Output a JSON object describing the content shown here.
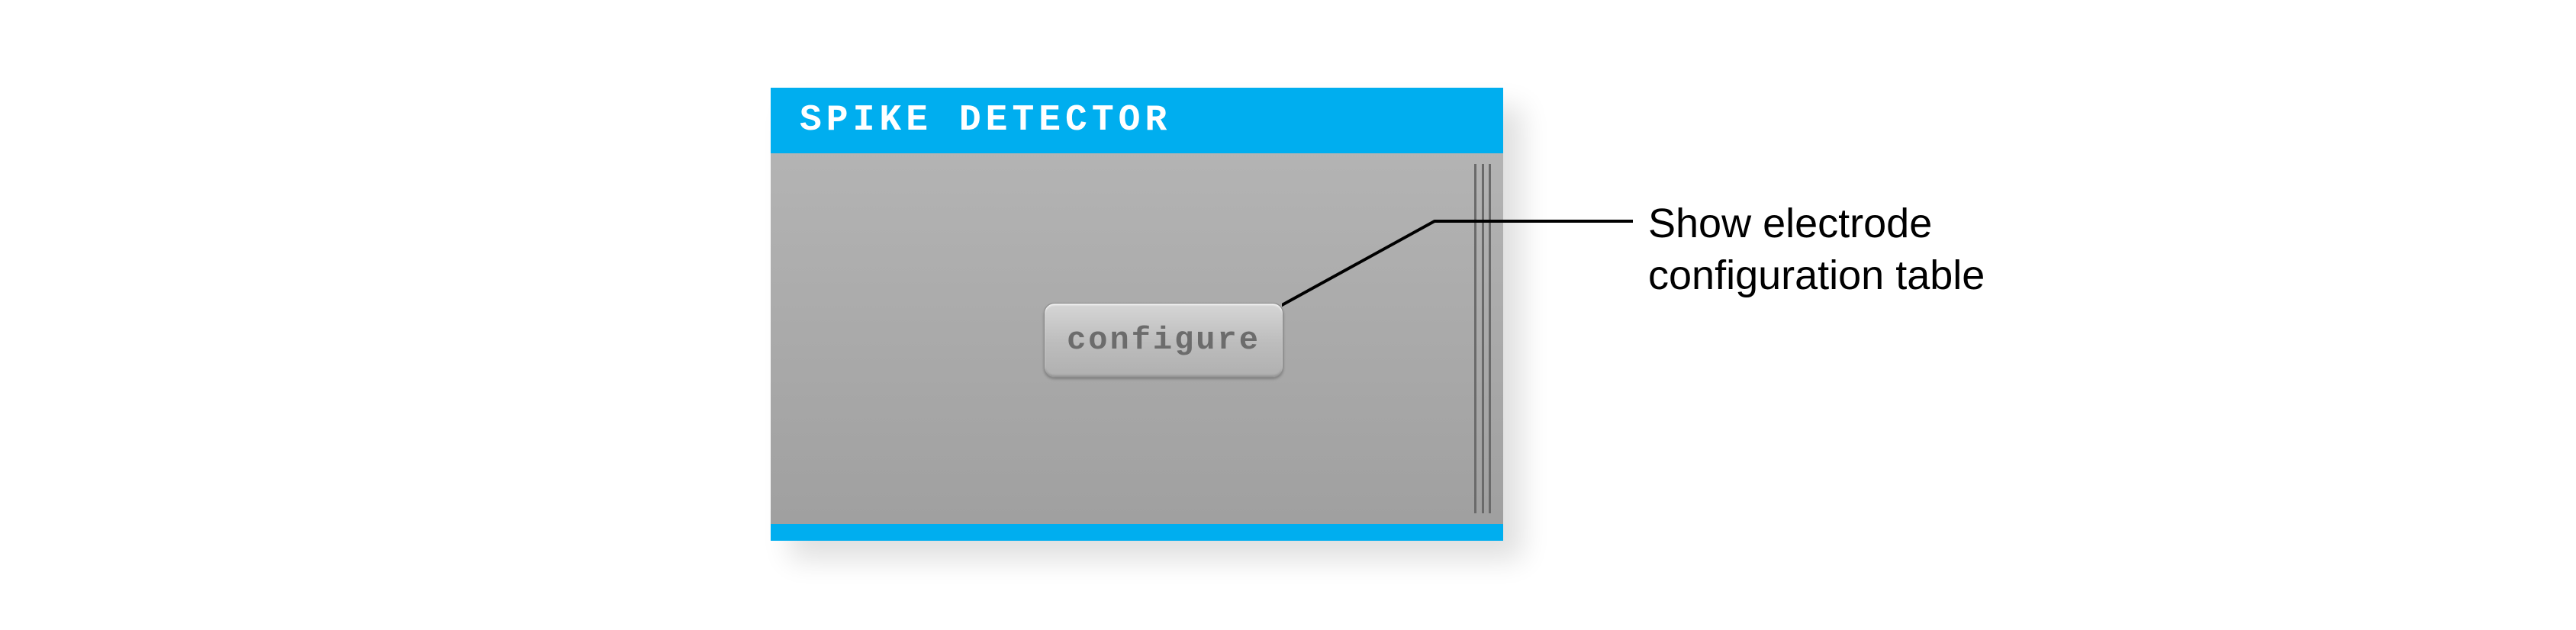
{
  "panel": {
    "title": "SPIKE DETECTOR",
    "button_label": "configure"
  },
  "annotation": {
    "line1": "Show electrode",
    "line2": "configuration table"
  },
  "colors": {
    "accent": "#00aeef",
    "panel_bg_top": "#b7b7b7",
    "panel_bg_bottom": "#9f9f9f"
  }
}
